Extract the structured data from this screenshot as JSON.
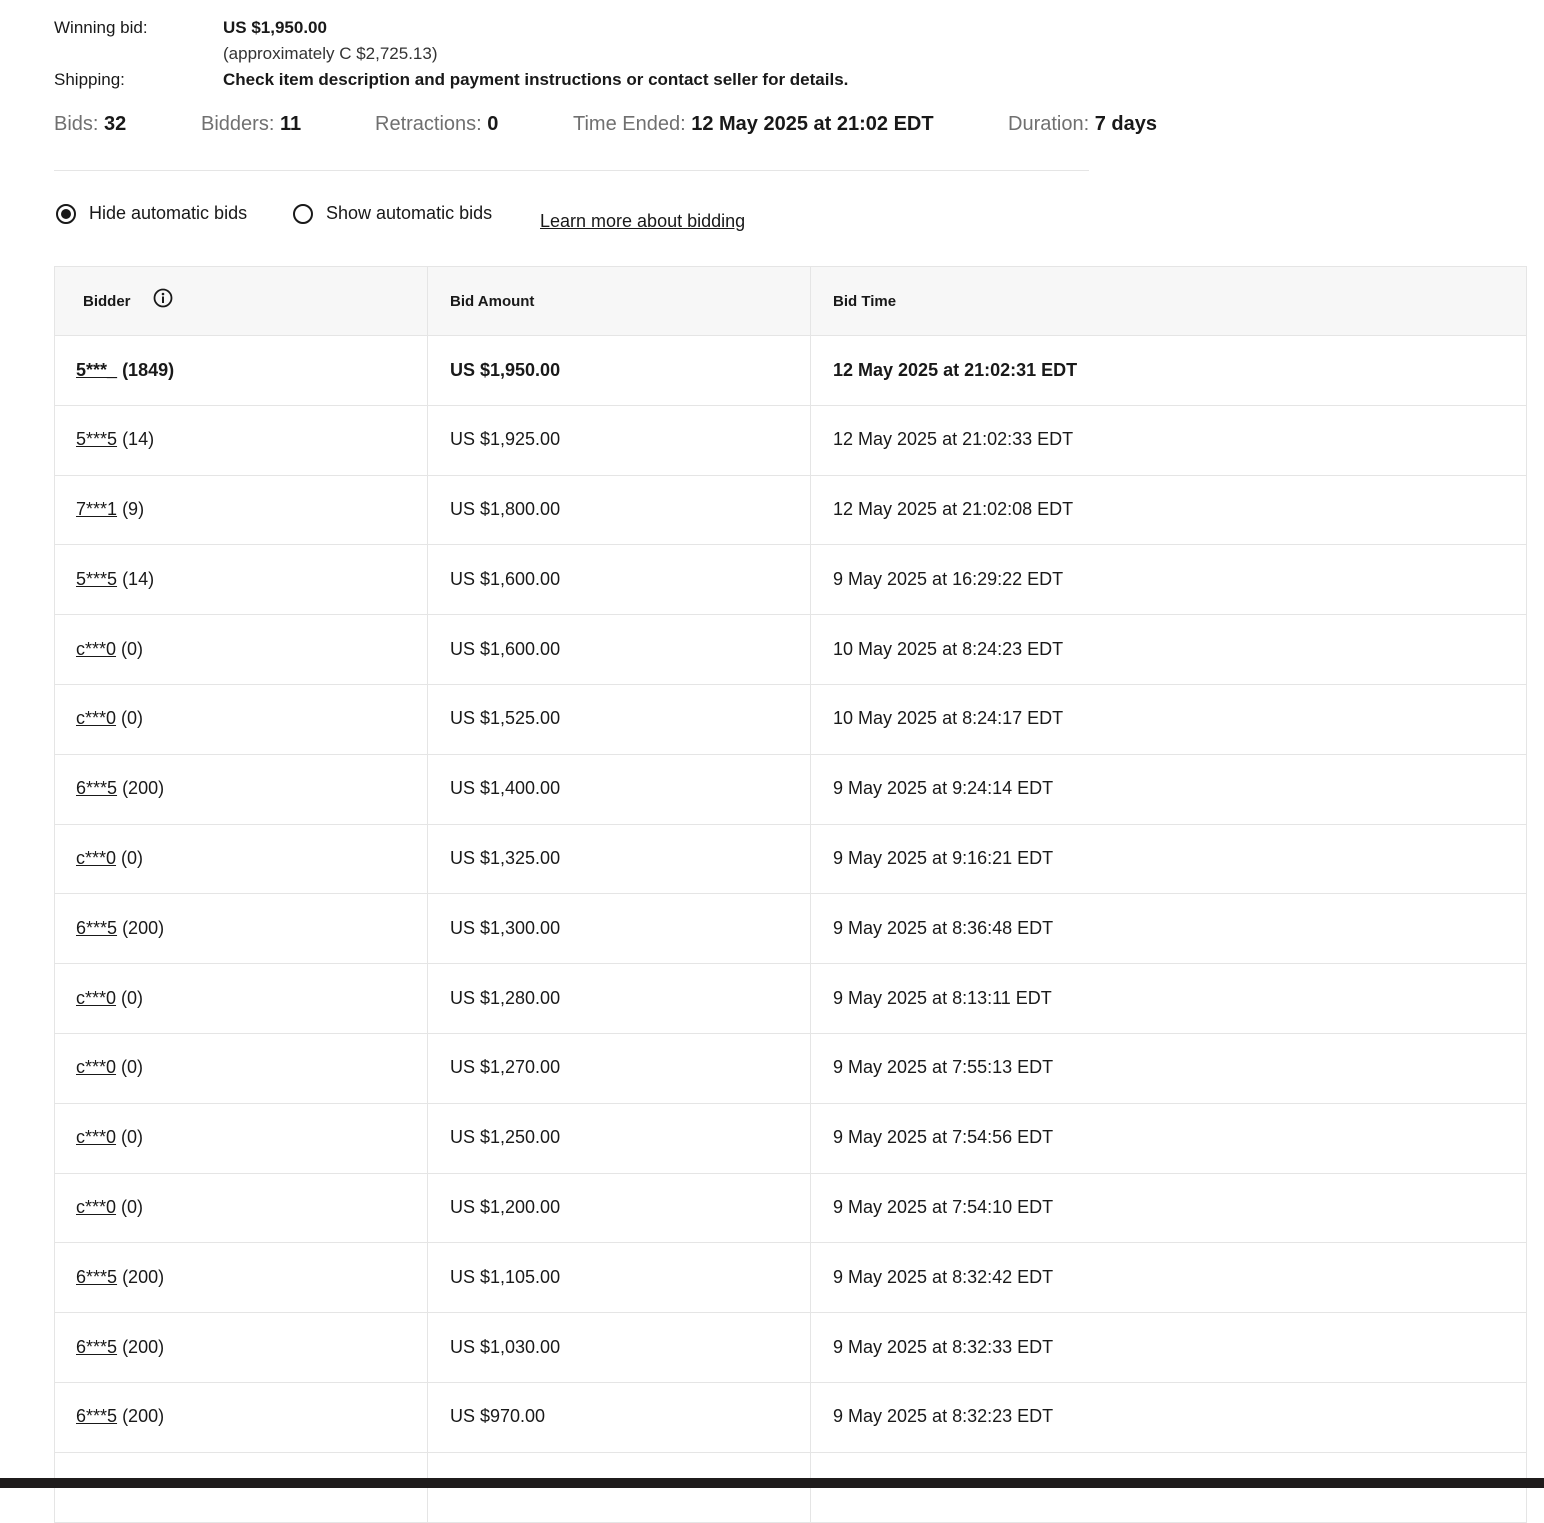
{
  "summary": {
    "winning_bid_label": "Winning bid:",
    "winning_bid_value": "US $1,950.00",
    "winning_bid_approx": "(approximately C $2,725.13)",
    "shipping_label": "Shipping:",
    "shipping_value": "Check item description and payment instructions or contact seller for details."
  },
  "stats": {
    "bids_label": "Bids:",
    "bids_value": "32",
    "bidders_label": "Bidders:",
    "bidders_value": "11",
    "retractions_label": "Retractions:",
    "retractions_value": "0",
    "time_ended_label": "Time Ended:",
    "time_ended_value": "12 May 2025 at 21:02 EDT",
    "duration_label": "Duration:",
    "duration_value": "7 days"
  },
  "options": {
    "hide_auto_label": "Hide automatic bids",
    "show_auto_label": "Show automatic bids",
    "selected": "hide",
    "learn_more_label": "Learn more about bidding"
  },
  "table": {
    "headers": [
      "Bidder",
      "Bid Amount",
      "Bid Time"
    ],
    "rows": [
      {
        "bidder": "5***_",
        "feedback": "(1849)",
        "amount": "US $1,950.00",
        "time": "12 May 2025 at 21:02:31 EDT"
      },
      {
        "bidder": "5***5",
        "feedback": "(14)",
        "amount": "US $1,925.00",
        "time": "12 May 2025 at 21:02:33 EDT"
      },
      {
        "bidder": "7***1",
        "feedback": "(9)",
        "amount": "US $1,800.00",
        "time": "12 May 2025 at 21:02:08 EDT"
      },
      {
        "bidder": "5***5",
        "feedback": "(14)",
        "amount": "US $1,600.00",
        "time": "9 May 2025 at 16:29:22 EDT"
      },
      {
        "bidder": "c***0",
        "feedback": "(0)",
        "amount": "US $1,600.00",
        "time": "10 May 2025 at 8:24:23 EDT"
      },
      {
        "bidder": "c***0",
        "feedback": "(0)",
        "amount": "US $1,525.00",
        "time": "10 May 2025 at 8:24:17 EDT"
      },
      {
        "bidder": "6***5",
        "feedback": "(200)",
        "amount": "US $1,400.00",
        "time": "9 May 2025 at 9:24:14 EDT"
      },
      {
        "bidder": "c***0",
        "feedback": "(0)",
        "amount": "US $1,325.00",
        "time": "9 May 2025 at 9:16:21 EDT"
      },
      {
        "bidder": "6***5",
        "feedback": "(200)",
        "amount": "US $1,300.00",
        "time": "9 May 2025 at 8:36:48 EDT"
      },
      {
        "bidder": "c***0",
        "feedback": "(0)",
        "amount": "US $1,280.00",
        "time": "9 May 2025 at 8:13:11 EDT"
      },
      {
        "bidder": "c***0",
        "feedback": "(0)",
        "amount": "US $1,270.00",
        "time": "9 May 2025 at 7:55:13 EDT"
      },
      {
        "bidder": "c***0",
        "feedback": "(0)",
        "amount": "US $1,250.00",
        "time": "9 May 2025 at 7:54:56 EDT"
      },
      {
        "bidder": "c***0",
        "feedback": "(0)",
        "amount": "US $1,200.00",
        "time": "9 May 2025 at 7:54:10 EDT"
      },
      {
        "bidder": "6***5",
        "feedback": "(200)",
        "amount": "US $1,105.00",
        "time": "9 May 2025 at 8:32:42 EDT"
      },
      {
        "bidder": "6***5",
        "feedback": "(200)",
        "amount": "US $1,030.00",
        "time": "9 May 2025 at 8:32:33 EDT"
      },
      {
        "bidder": "6***5",
        "feedback": "(200)",
        "amount": "US $970.00",
        "time": "9 May 2025 at 8:32:23 EDT"
      },
      {
        "bidder": "",
        "feedback": "",
        "amount": "",
        "time": ""
      }
    ]
  }
}
